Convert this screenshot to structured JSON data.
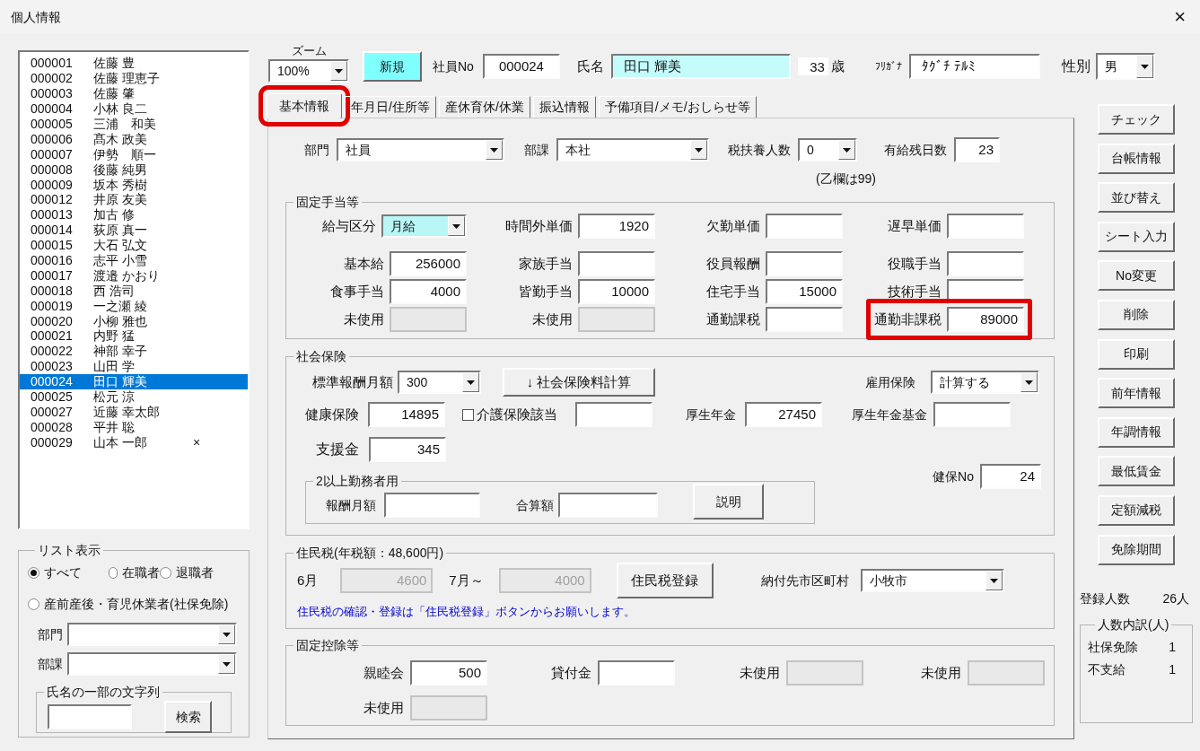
{
  "window": {
    "title": "個人情報",
    "close": "×"
  },
  "employees": [
    {
      "no": "000001",
      "name": "佐藤 豊",
      "selected": false
    },
    {
      "no": "000002",
      "name": "佐藤 理恵子",
      "selected": false
    },
    {
      "no": "000003",
      "name": "佐藤 肇",
      "selected": false
    },
    {
      "no": "000004",
      "name": "小林 良二",
      "selected": false
    },
    {
      "no": "000005",
      "name": "三浦　和美",
      "selected": false
    },
    {
      "no": "000006",
      "name": "髙木 政美",
      "selected": false
    },
    {
      "no": "000007",
      "name": "伊勢　順一",
      "selected": false
    },
    {
      "no": "000008",
      "name": "後藤 純男",
      "selected": false
    },
    {
      "no": "000009",
      "name": "坂本 秀樹",
      "selected": false
    },
    {
      "no": "000012",
      "name": "井原 友美",
      "selected": false
    },
    {
      "no": "000013",
      "name": "加古 修",
      "selected": false
    },
    {
      "no": "000014",
      "name": "荻原 真一",
      "selected": false
    },
    {
      "no": "000015",
      "name": "大石 弘文",
      "selected": false
    },
    {
      "no": "000016",
      "name": "志平 小雪",
      "selected": false
    },
    {
      "no": "000017",
      "name": "渡邉 かおり",
      "selected": false
    },
    {
      "no": "000018",
      "name": "西 浩司",
      "selected": false
    },
    {
      "no": "000019",
      "name": "一之瀬 綾",
      "selected": false
    },
    {
      "no": "000020",
      "name": "小柳 雅也",
      "selected": false
    },
    {
      "no": "000021",
      "name": "内野 猛",
      "selected": false
    },
    {
      "no": "000022",
      "name": "神部 幸子",
      "selected": false
    },
    {
      "no": "000023",
      "name": "山田 学",
      "selected": false
    },
    {
      "no": "000024",
      "name": "田口 輝美",
      "selected": true
    },
    {
      "no": "000025",
      "name": "松元 涼",
      "selected": false
    },
    {
      "no": "000027",
      "name": "近藤 幸太郎",
      "selected": false
    },
    {
      "no": "000028",
      "name": "平井 聡",
      "selected": false
    },
    {
      "no": "000029",
      "name": "山本 一郎",
      "mark": "×",
      "selected": false
    }
  ],
  "list_filter": {
    "title": "リスト表示",
    "options": [
      {
        "label": "すべて",
        "selected": true
      },
      {
        "label": "在職者",
        "selected": false
      },
      {
        "label": "退職者",
        "selected": false
      },
      {
        "label": "産前産後・育児休業者(社保免除)",
        "selected": false
      }
    ],
    "dept_label": "部門",
    "section_label": "部課",
    "search_title": "氏名の一部の文字列",
    "search_button": "検索"
  },
  "header": {
    "zoom_label": "ズーム",
    "zoom": "100%",
    "new_button": "新規",
    "emp_no_label": "社員No",
    "emp_no": "000024",
    "name_label": "氏名",
    "name": "田口 輝美",
    "age": "33",
    "age_unit": "歳",
    "kana_label": "ﾌﾘｶﾞﾅ",
    "kana": "ﾀｸﾞﾁ ﾃﾙﾐ",
    "gender_label": "性別",
    "gender": "男"
  },
  "tabs": [
    {
      "label": "基本情報",
      "selected": true,
      "highlighted": true
    },
    {
      "label": "年月日/住所等",
      "selected": false,
      "highlighted": false
    },
    {
      "label": "産休育休/休業",
      "selected": false,
      "highlighted": false
    },
    {
      "label": "振込情報",
      "selected": false,
      "highlighted": false
    },
    {
      "label": "予備項目/メモ/おしらせ等",
      "selected": false,
      "highlighted": false
    }
  ],
  "basic": {
    "dept": {
      "label": "部門",
      "value": "社員"
    },
    "section": {
      "label": "部課",
      "value": "本社"
    },
    "dependents": {
      "label": "税扶養人数",
      "value": "0",
      "note": "(乙欄は99)"
    },
    "paid_leave": {
      "label": "有給残日数",
      "value": "23"
    }
  },
  "fixed_allowances": {
    "title": "固定手当等",
    "items": [
      {
        "kind": "select",
        "label": "給与区分",
        "value": "月給",
        "highlighted": false
      },
      {
        "kind": "field",
        "label": "時間外単価",
        "value": "1920",
        "disabled": false,
        "highlighted": false
      },
      {
        "kind": "field",
        "label": "欠勤単価",
        "disabled": false,
        "highlighted": false
      },
      {
        "kind": "field",
        "label": "遅早単価",
        "disabled": false,
        "highlighted": false
      },
      {
        "kind": "field",
        "label": "基本給",
        "value": "256000",
        "disabled": false,
        "highlighted": false
      },
      {
        "kind": "field",
        "label": "家族手当",
        "disabled": false,
        "highlighted": false
      },
      {
        "kind": "field",
        "label": "役員報酬",
        "disabled": false,
        "highlighted": false
      },
      {
        "kind": "field",
        "label": "役職手当",
        "disabled": false,
        "highlighted": false
      },
      {
        "kind": "field",
        "label": "食事手当",
        "value": "4000",
        "disabled": false,
        "highlighted": false
      },
      {
        "kind": "field",
        "label": "皆勤手当",
        "value": "10000",
        "disabled": false,
        "highlighted": false
      },
      {
        "kind": "field",
        "label": "住宅手当",
        "value": "15000",
        "disabled": false,
        "highlighted": false
      },
      {
        "kind": "field",
        "label": "技術手当",
        "disabled": false,
        "highlighted": false
      },
      {
        "kind": "field",
        "label": "未使用",
        "disabled": true,
        "highlighted": false
      },
      {
        "kind": "field",
        "label": "未使用",
        "disabled": true,
        "highlighted": false
      },
      {
        "kind": "field",
        "label": "通勤課税",
        "disabled": false,
        "highlighted": false
      },
      {
        "kind": "field",
        "label": "通勤非課税",
        "value": "89000",
        "disabled": false,
        "highlighted": true
      }
    ]
  },
  "social_insurance": {
    "title": "社会保険",
    "standard_monthly": {
      "label": "標準報酬月額",
      "value": "300"
    },
    "calc_button": "↓  社会保険料計算",
    "employment_insurance": {
      "label": "雇用保険",
      "value": "計算する"
    },
    "health": {
      "label": "健康保険",
      "value": "14895"
    },
    "care_insurance": {
      "label": "介護保険該当",
      "checked": false
    },
    "pension": {
      "label": "厚生年金",
      "value": "27450"
    },
    "pension_fund": {
      "label": "厚生年金基金"
    },
    "support": {
      "label": "支援金",
      "value": "345"
    },
    "multi_work": {
      "title": "2以上勤務者用",
      "monthly_label": "報酬月額",
      "total_label": "合算額",
      "button": "説明"
    },
    "health_no": {
      "label": "健保No",
      "value": "24"
    }
  },
  "resident_tax": {
    "title": "住民税(年税額：48,600円)",
    "june": {
      "label": "6月",
      "value": "4600",
      "disabled": true
    },
    "july": {
      "label": "7月～",
      "value": "4000",
      "disabled": true
    },
    "register_button": "住民税登録",
    "city": {
      "label": "納付先市区町村",
      "value": "小牧市"
    },
    "note": "住民税の確認・登録は「住民税登録」ボタンからお願いします。"
  },
  "deductions": {
    "title": "固定控除等",
    "items": [
      {
        "label": "親睦会",
        "value": "500",
        "disabled": false
      },
      {
        "label": "貸付金",
        "disabled": false
      },
      {
        "label": "未使用",
        "disabled": true
      },
      {
        "label": "未使用",
        "disabled": true
      },
      {
        "label": "未使用",
        "disabled": true
      }
    ]
  },
  "side_buttons": [
    "チェック",
    "台帳情報",
    "並び替え",
    "シート入力",
    "No変更",
    "削除",
    "印刷",
    "前年情報",
    "年調情報",
    "最低賃金",
    "定額減税",
    "免除期間"
  ],
  "registered": {
    "label": "登録人数",
    "value": "26人"
  },
  "breakdown": {
    "title": "人数内訳(人)",
    "rows": [
      {
        "label": "社保免除",
        "value": "1"
      },
      {
        "label": "不支給",
        "value": "1"
      }
    ]
  }
}
